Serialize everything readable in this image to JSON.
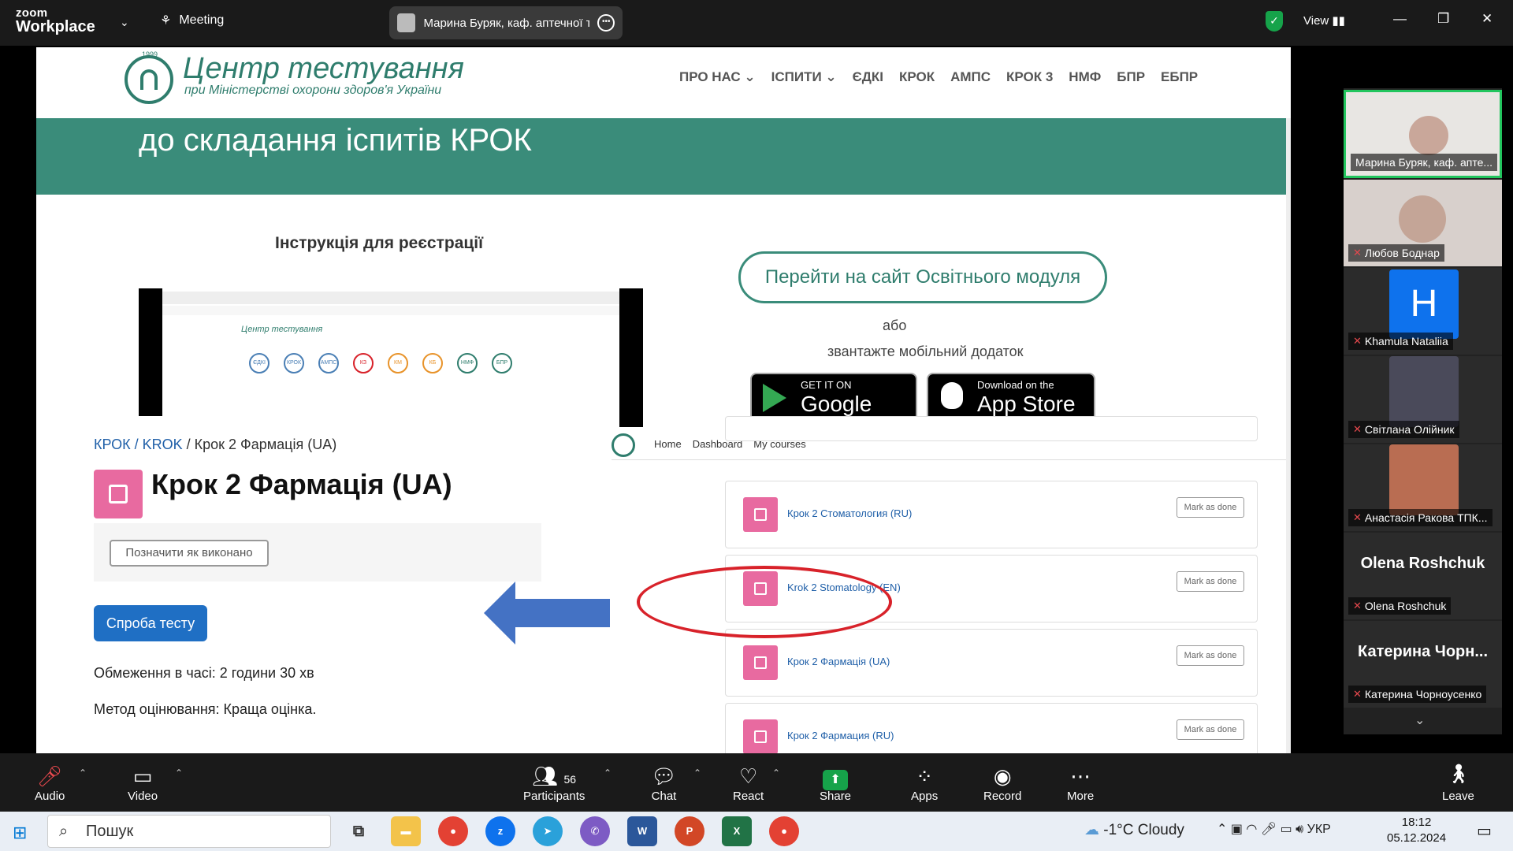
{
  "zoom": {
    "brand_line1": "zoom",
    "brand_line2": "Workplace",
    "meeting_label": "Meeting",
    "active_speaker": "Марина Буряк, каф. аптечної те",
    "view_label": "View"
  },
  "slide": {
    "logo_title": "Центр тестування",
    "logo_subtitle": "при Міністерстві охорони здоров'я України",
    "logo_year": "1999",
    "nav": [
      "ПРО НАС ⌄",
      "ІСПИТИ ⌄",
      "ЄДКІ",
      "КРОК",
      "АМПС",
      "КРОК 3",
      "НМФ",
      "БПР",
      "ЕБПР"
    ],
    "banner_text": "до складання іспитів КРОК",
    "instruction_title": "Інструкція для реєстрації",
    "mini_logo": "Центр тестування",
    "mini_circles": [
      "ЄДКІ",
      "КРОК",
      "АМПС",
      "КЗ",
      "КМ",
      "КБ",
      "НМФ",
      "БПР"
    ],
    "goto_button": "Перейти на сайт Освітнього модуля",
    "or_text": "або",
    "download_text": "звантажте мобільний додаток",
    "google_top": "GET IT ON",
    "google_main": "Google Play",
    "apple_top": "Download on the",
    "apple_main": "App Store",
    "breadcrumb_link": "КРОК / KROK",
    "breadcrumb_sep": "/",
    "breadcrumb_current": "Крок 2 Фармація (UA)",
    "course_title": "Крок 2 Фармація (UA)",
    "mark_done_ua": "Позначити як виконано",
    "attempt_button": "Спроба тесту",
    "time_limit": "Обмеження в часі: 2 години 30 хв",
    "grading_method": "Метод оцінювання: Краща оцінка.",
    "rp_nav": [
      "Home",
      "Dashboard",
      "My courses"
    ],
    "courses": [
      {
        "name": "Крок 2 Стоматология (RU)",
        "mark": "Mark as done"
      },
      {
        "name": "Krok 2 Stomatology (EN)",
        "mark": "Mark as done"
      },
      {
        "name": "Крок 2 Фармація (UA)",
        "mark": "Mark as done"
      },
      {
        "name": "Крок 2 Фармация (RU)",
        "mark": "Mark as done"
      }
    ]
  },
  "participants": [
    {
      "name": "Марина Буряк, каф. апте..."
    },
    {
      "name": "Любов Боднар"
    },
    {
      "name": "Khamula Nataliia",
      "initial": "H"
    },
    {
      "name": "Світлана Олійник"
    },
    {
      "name": "Анастасія Ракова ТПК..."
    },
    {
      "name": "Olena Roshchuk",
      "big": "Olena Roshchuk"
    },
    {
      "name": "Катерина Чорноусенко",
      "big": "Катерина Чорн..."
    }
  ],
  "controls": {
    "audio": "Audio",
    "video": "Video",
    "participants": "Participants",
    "participants_count": "56",
    "chat": "Chat",
    "react": "React",
    "share": "Share",
    "apps": "Apps",
    "record": "Record",
    "more": "More",
    "leave": "Leave"
  },
  "taskbar": {
    "search": "Пошук",
    "weather": "-1°C  Cloudy",
    "lang": "УКР",
    "time": "18:12",
    "date": "05.12.2024"
  },
  "colors": {
    "teal": "#3a8c7a",
    "pink": "#e86aa0",
    "link": "#1f5fa8",
    "red_oval": "#d8222a",
    "arrow_blue": "#4472c4",
    "zoom_blue": "#0e72ed",
    "share_green": "#16a34a"
  }
}
